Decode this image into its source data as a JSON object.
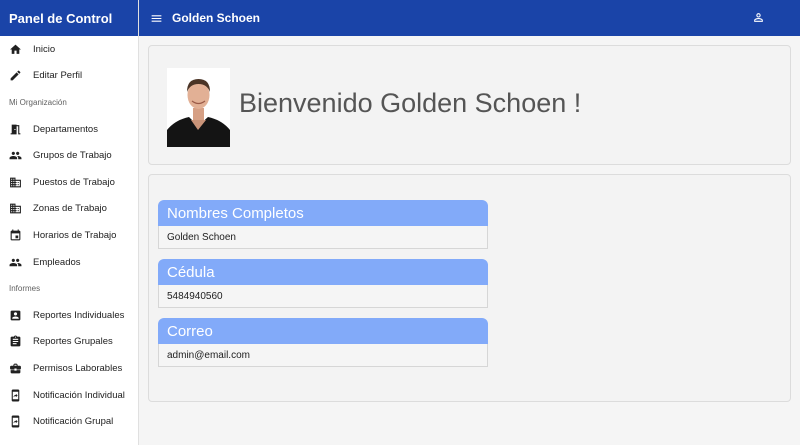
{
  "sidebar": {
    "title": "Panel de Control",
    "items_top": [
      {
        "label": "Inicio",
        "icon": "home-icon"
      },
      {
        "label": "Editar Perfil",
        "icon": "pencil-icon"
      }
    ],
    "section1_label": "Mi Organización",
    "items_org": [
      {
        "label": "Departamentos",
        "icon": "door-icon"
      },
      {
        "label": "Grupos de Trabajo",
        "icon": "people-icon"
      },
      {
        "label": "Puestos de Trabajo",
        "icon": "building-icon"
      },
      {
        "label": "Zonas de Trabajo",
        "icon": "building-icon"
      },
      {
        "label": "Horarios de Trabajo",
        "icon": "calendar-icon"
      },
      {
        "label": "Empleados",
        "icon": "people-icon"
      }
    ],
    "section2_label": "Informes",
    "items_reports": [
      {
        "label": "Reportes Individuales",
        "icon": "badge-icon"
      },
      {
        "label": "Reportes Grupales",
        "icon": "clipboard-icon"
      },
      {
        "label": "Permisos Laborables",
        "icon": "briefcase-icon"
      },
      {
        "label": "Notificación Individual",
        "icon": "phone-icon"
      },
      {
        "label": "Notificación Grupal",
        "icon": "phone-icon"
      }
    ]
  },
  "topbar": {
    "title": "Golden Schoen",
    "account_icon": "account-icon",
    "menu_icon": "menu-icon"
  },
  "welcome": {
    "text": "Bienvenido Golden Schoen !"
  },
  "profile": {
    "name_label": "Nombres Completos",
    "name_value": "Golden Schoen",
    "id_label": "Cédula",
    "id_value": "5484940560",
    "email_label": "Correo",
    "email_value": "admin@email.com"
  },
  "colors": {
    "primary": "#1a44a8",
    "field_header": "#82aaf9"
  }
}
